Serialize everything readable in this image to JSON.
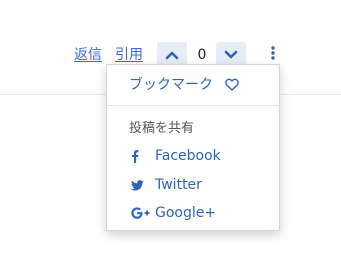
{
  "toolbar": {
    "reply_label": "返信",
    "quote_label": "引用",
    "upvote_icon": "chevron-up-icon",
    "vote_count": "0",
    "downvote_icon": "chevron-down-icon",
    "more_icon": "vertical-dots-icon"
  },
  "menu": {
    "bookmark_label": "ブックマーク",
    "bookmark_icon": "heart-outline-icon",
    "share_header": "投稿を共有",
    "share_items": [
      {
        "label": "Facebook",
        "icon": "facebook-icon"
      },
      {
        "label": "Twitter",
        "icon": "twitter-icon"
      },
      {
        "label": "Google+",
        "icon": "google-plus-icon"
      }
    ]
  },
  "colors": {
    "link": "#3a6ed2",
    "menu_link": "#2d64c5",
    "vote_bg": "#e7edf6",
    "icon_blue": "#2a63c4",
    "border": "#d6d6d6",
    "muted_text": "#555555"
  }
}
